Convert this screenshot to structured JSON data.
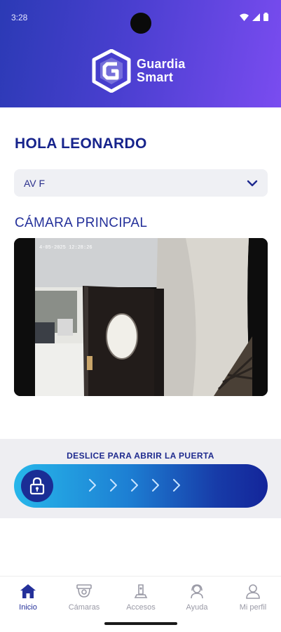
{
  "status_bar": {
    "time": "3:28"
  },
  "brand": {
    "line1": "Guardia",
    "line2": "Smart"
  },
  "greeting": "HOLA LEONARDO",
  "location_select": {
    "value": "AV F"
  },
  "camera": {
    "title": "CÁMARA PRINCIPAL",
    "overlay_timestamp": "4-05-2025 12:28:26"
  },
  "unlock": {
    "instruction": "DESLICE PARA ABRIR LA PUERTA"
  },
  "nav": {
    "items": [
      {
        "label": "Inicio",
        "icon": "home-icon",
        "active": true
      },
      {
        "label": "Cámaras",
        "icon": "dome-camera-icon",
        "active": false
      },
      {
        "label": "Accesos",
        "icon": "access-icon",
        "active": false
      },
      {
        "label": "Ayuda",
        "icon": "help-icon",
        "active": false
      },
      {
        "label": "Mi perfil",
        "icon": "profile-icon",
        "active": false
      }
    ]
  },
  "colors": {
    "primary": "#24309a",
    "header_start": "#2b3ab5",
    "header_end": "#7a4cf0",
    "slider_start": "#27b6ea"
  }
}
